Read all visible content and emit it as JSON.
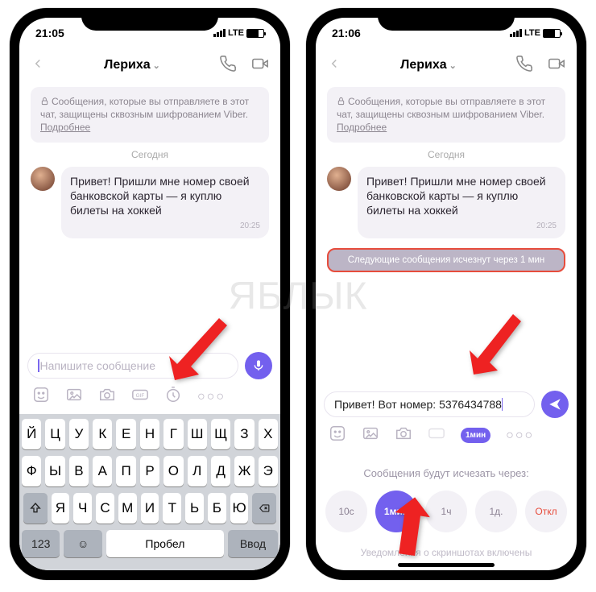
{
  "watermark": "ЯБЛЫК",
  "left": {
    "time": "21:05",
    "net": "LTE",
    "chat_name": "Лериха",
    "encryption": "Сообщения, которые вы отправляете в этот чат, защищены сквозным шифрованием Viber.",
    "more": "Подробнее",
    "date": "Сегодня",
    "msg": "Привет! Пришли мне номер своей банковской карты — я куплю билеты на хоккей",
    "msg_time": "20:25",
    "placeholder": "Напишите сообщение",
    "kb": {
      "r1": [
        "Й",
        "Ц",
        "У",
        "К",
        "Е",
        "Н",
        "Г",
        "Ш",
        "Щ",
        "З",
        "Х"
      ],
      "r2": [
        "Ф",
        "Ы",
        "В",
        "А",
        "П",
        "Р",
        "О",
        "Л",
        "Д",
        "Ж",
        "Э"
      ],
      "r3": [
        "Я",
        "Ч",
        "С",
        "М",
        "И",
        "Т",
        "Ь",
        "Б",
        "Ю"
      ],
      "num": "123",
      "space": "Пробел",
      "enter": "Ввод"
    }
  },
  "right": {
    "time": "21:06",
    "net": "LTE",
    "chat_name": "Лериха",
    "encryption": "Сообщения, которые вы отправляете в этот чат, защищены сквозным шифрованием Viber.",
    "more": "Подробнее",
    "date": "Сегодня",
    "msg": "Привет! Пришли мне номер своей банковской карты — я куплю билеты на хоккей",
    "msg_time": "20:25",
    "banner": "Следующие сообщения исчезнут через 1 мин",
    "draft": "Привет! Вот номер: 5376434788",
    "timer_label": "1мин",
    "panel_title": "Сообщения будут исчезать через:",
    "options": [
      "10с",
      "1мин",
      "1ч",
      "1д.",
      "Откл"
    ],
    "panel_footer": "Уведомления о скриншотах включены"
  }
}
